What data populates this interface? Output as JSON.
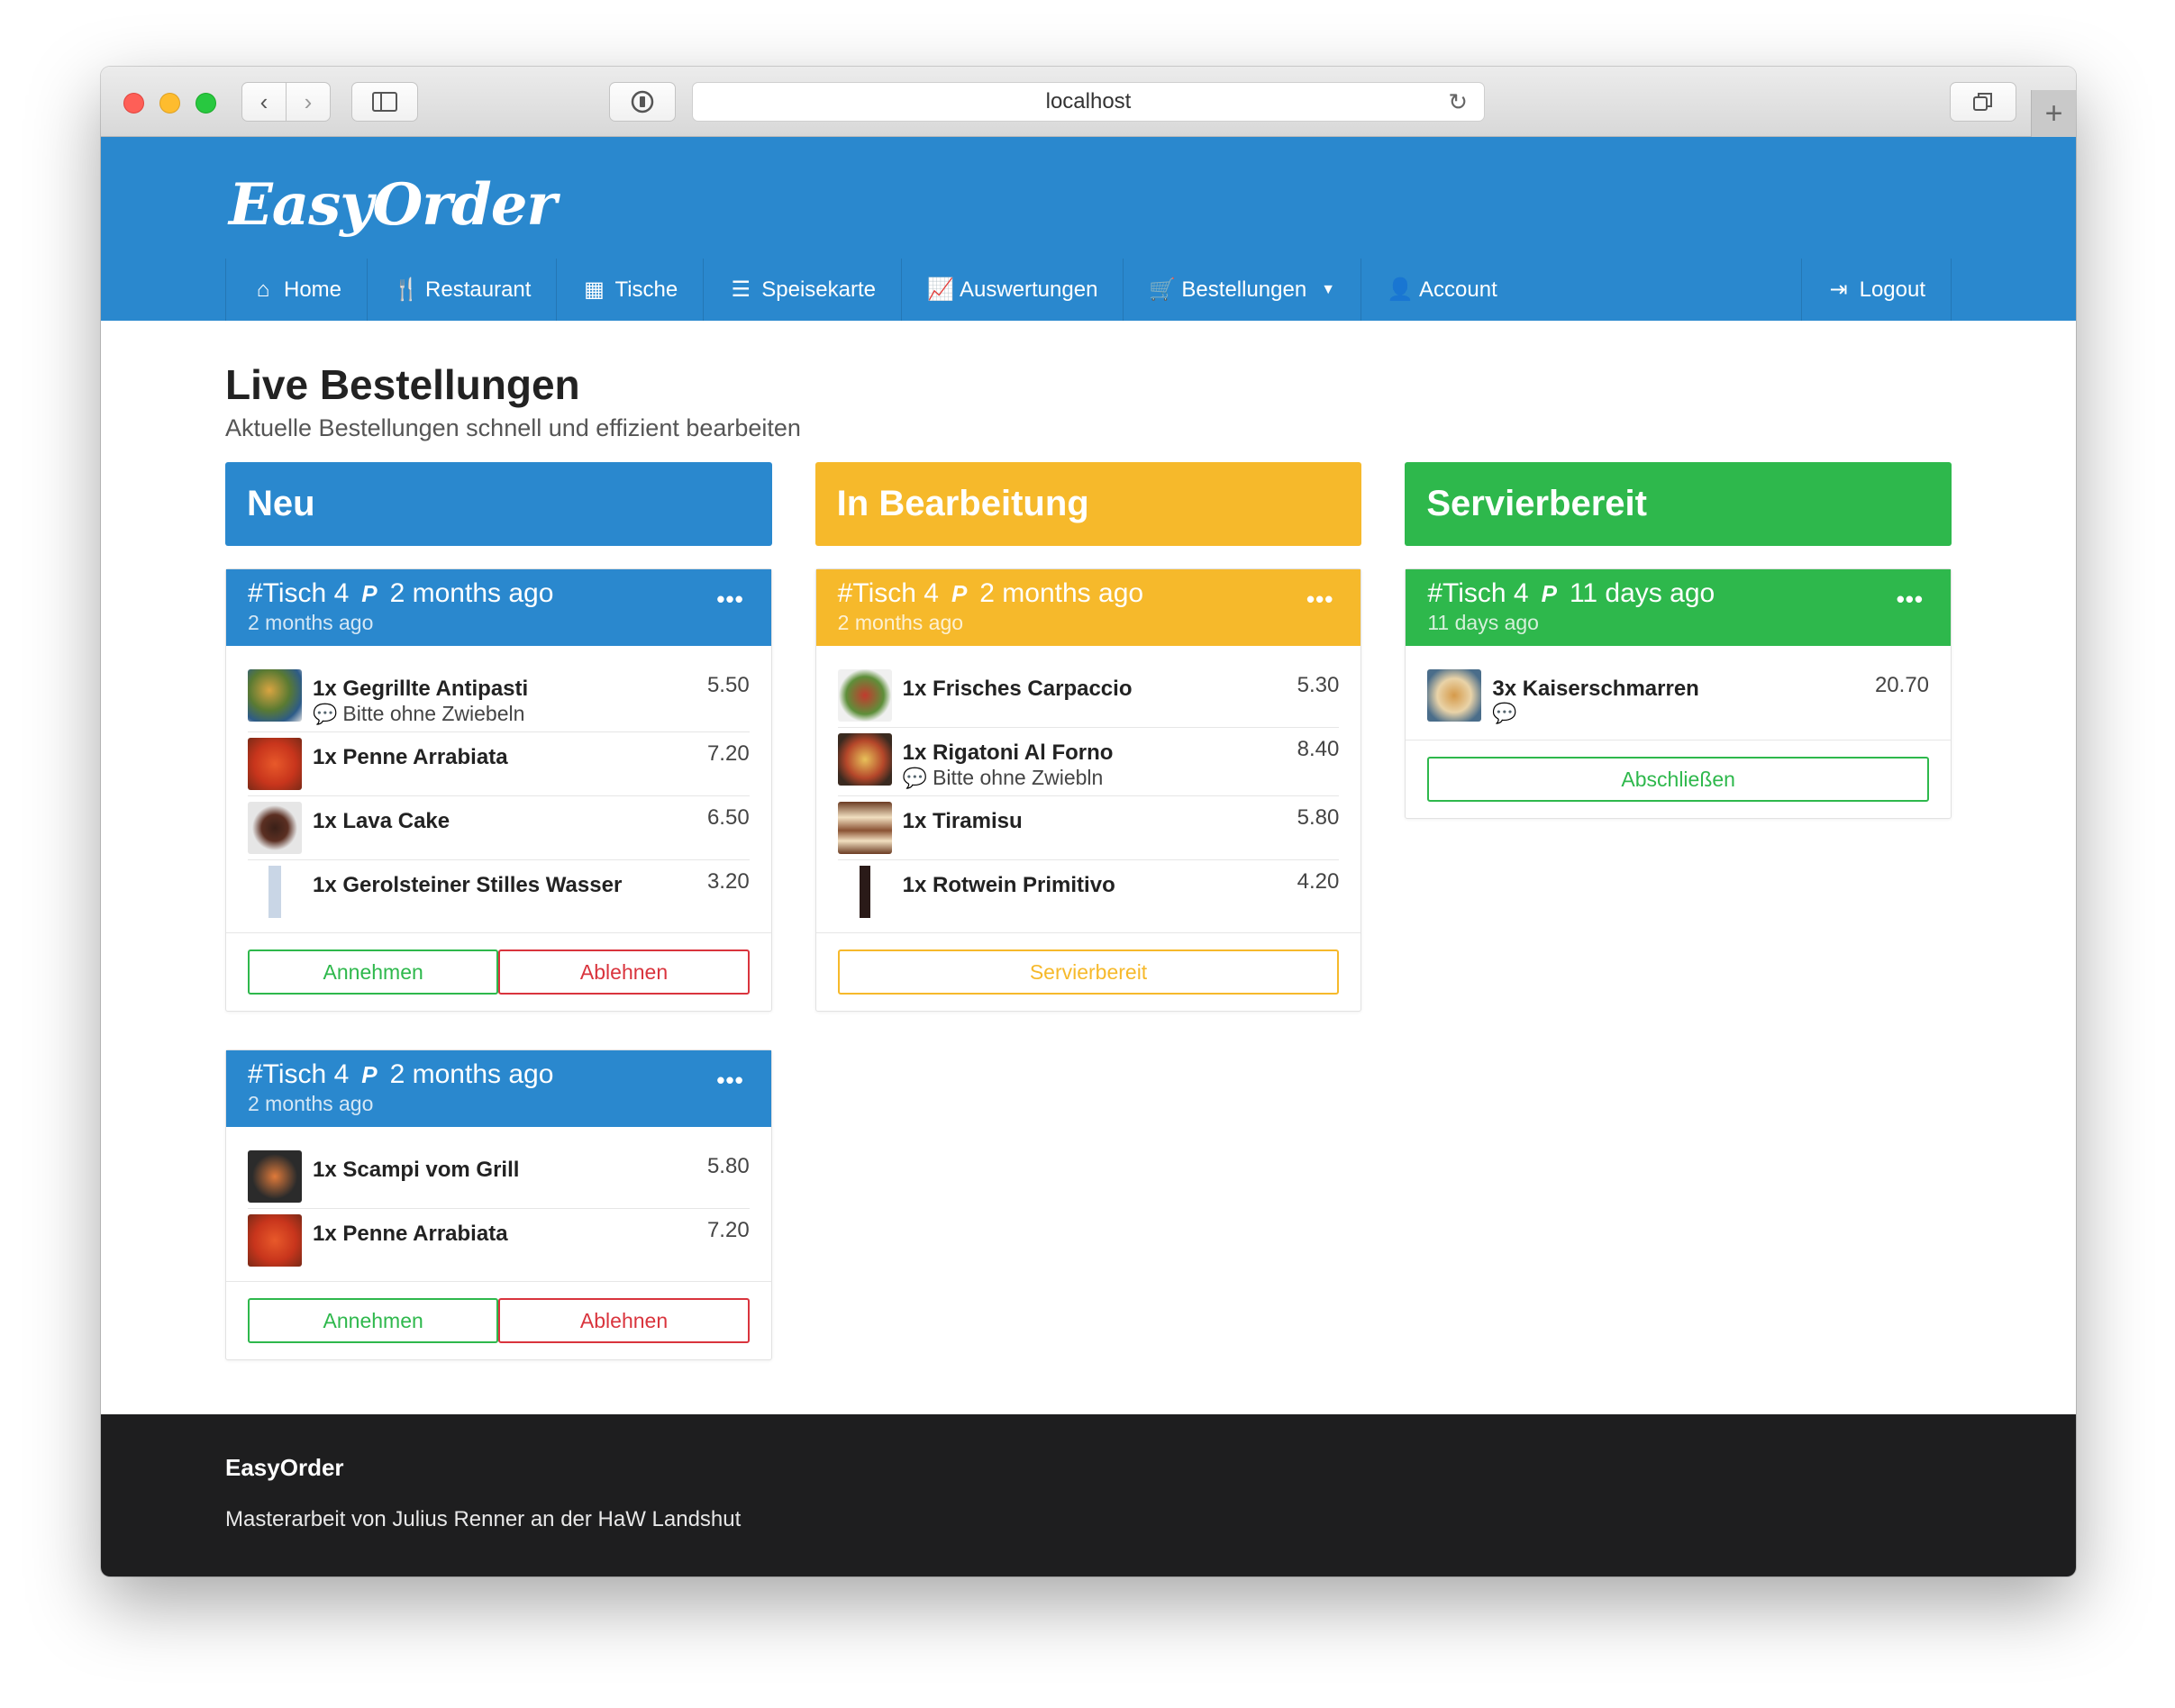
{
  "colors": {
    "header": "#2a88ce",
    "neu": "#2a88ce",
    "bearbeitung": "#f6b92b",
    "servierbereit": "#2eb84c",
    "red": "#d9343d",
    "footer": "#1e1e1f"
  },
  "browser": {
    "url": "localhost",
    "icons": [
      "chevron-left-icon",
      "chevron-right-icon",
      "sidebar-icon",
      "shield-icon",
      "reload-icon",
      "tabs-icon",
      "plus-icon"
    ]
  },
  "header": {
    "logo": "EasyOrder",
    "nav": [
      {
        "label": "Home",
        "icon": "home-icon"
      },
      {
        "label": "Restaurant",
        "icon": "cutlery-icon"
      },
      {
        "label": "Tische",
        "icon": "grid-icon"
      },
      {
        "label": "Speisekarte",
        "icon": "list-icon"
      },
      {
        "label": "Auswertungen",
        "icon": "chart-icon"
      },
      {
        "label": "Bestellungen",
        "icon": "cart-icon"
      },
      {
        "label": "Account",
        "icon": "user-icon"
      }
    ],
    "logout": "Logout"
  },
  "page": {
    "title": "Live Bestellungen",
    "subtitle": "Aktuelle Bestellungen schnell und effizient bearbeiten"
  },
  "columns": [
    {
      "title": "Neu",
      "orders": [
        {
          "table": "#Tisch 4",
          "ago": "2 months ago",
          "sub": "2 months ago",
          "items": [
            {
              "name": "1x Gegrillte Antipasti",
              "note": "Bitte ohne Zwiebeln",
              "price": "5.50"
            },
            {
              "name": "1x Penne Arrabiata",
              "price": "7.20"
            },
            {
              "name": "1x Lava Cake",
              "price": "6.50"
            },
            {
              "name": "1x Gerolsteiner Stilles Wasser",
              "price": "3.20"
            }
          ],
          "accept": "Annehmen",
          "decline": "Ablehnen"
        },
        {
          "table": "#Tisch 4",
          "ago": "2 months ago",
          "sub": "2 months ago",
          "items": [
            {
              "name": "1x Scampi vom Grill",
              "price": "5.80"
            },
            {
              "name": "1x Penne Arrabiata",
              "price": "7.20"
            }
          ],
          "accept": "Annehmen",
          "decline": "Ablehnen"
        }
      ]
    },
    {
      "title": "In Bearbeitung",
      "orders": [
        {
          "table": "#Tisch 4",
          "ago": "2 months ago",
          "sub": "2 months ago",
          "items": [
            {
              "name": "1x Frisches Carpaccio",
              "price": "5.30"
            },
            {
              "name": "1x Rigatoni Al Forno",
              "note": "Bitte ohne Zwiebln",
              "price": "8.40"
            },
            {
              "name": "1x Tiramisu",
              "price": "5.80"
            },
            {
              "name": "1x Rotwein Primitivo",
              "price": "4.20"
            }
          ],
          "action": "Servierbereit"
        }
      ]
    },
    {
      "title": "Servierbereit",
      "orders": [
        {
          "table": "#Tisch 4",
          "ago": "11 days ago",
          "sub": "11 days ago",
          "items": [
            {
              "name": "3x Kaiserschmarren",
              "note": "",
              "price": "20.70"
            }
          ],
          "action": "Abschließen"
        }
      ]
    }
  ],
  "footer": {
    "brand": "EasyOrder",
    "text": "Masterarbeit von Julius Renner an der HaW Landshut"
  }
}
